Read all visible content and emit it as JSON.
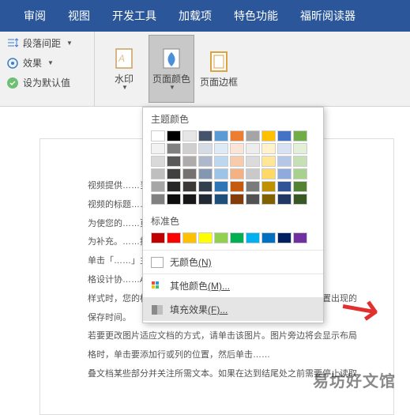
{
  "ribbon": {
    "tabs": [
      "审阅",
      "视图",
      "开发工具",
      "加载项",
      "特色功能",
      "福昕阅读器"
    ]
  },
  "leftGroup": {
    "paragraphSpacing": "段落间距",
    "effects": "效果",
    "setDefault": "设为默认值"
  },
  "pageBg": {
    "watermark": "水印",
    "pageColor": "页面颜色",
    "pageBorder": "页面边框"
  },
  "colorMenu": {
    "themeTitle": "主题颜色",
    "themeColors": [
      "#ffffff",
      "#000000",
      "#e7e6e6",
      "#44546a",
      "#5b9bd5",
      "#ed7d31",
      "#a5a5a5",
      "#ffc000",
      "#4472c4",
      "#70ad47",
      "#f2f2f2",
      "#808080",
      "#d0cece",
      "#d6dce5",
      "#deebf7",
      "#fce5d6",
      "#ededed",
      "#fff2cc",
      "#d9e2f3",
      "#e2f0d9",
      "#d9d9d9",
      "#595959",
      "#aeabab",
      "#adb9ca",
      "#bdd7ee",
      "#f8cbad",
      "#dbdbdb",
      "#ffe699",
      "#b4c7e7",
      "#c5e0b4",
      "#bfbfbf",
      "#404040",
      "#757171",
      "#8497b0",
      "#9dc3e6",
      "#f4b183",
      "#c9c9c9",
      "#ffd966",
      "#8faadc",
      "#a9d18e",
      "#a6a6a6",
      "#262626",
      "#3b3838",
      "#323f4f",
      "#2e75b6",
      "#c55a11",
      "#7b7b7b",
      "#bf9000",
      "#2f5597",
      "#548235",
      "#808080",
      "#0d0d0d",
      "#171717",
      "#222a35",
      "#1f4e79",
      "#843c0c",
      "#525252",
      "#806000",
      "#203864",
      "#385723"
    ],
    "standardTitle": "标准色",
    "standardColors": [
      "#c00000",
      "#ff0000",
      "#ffc000",
      "#ffff00",
      "#92d050",
      "#00b050",
      "#00b0f0",
      "#0070c0",
      "#002060",
      "#7030a0"
    ],
    "noColor": "无颜色",
    "noColorKey": "(N)",
    "otherColors": "其他颜色",
    "otherColorsKey": "(M)...",
    "fillEffects": "填充效果",
    "fillEffectsKey": "(F)..."
  },
  "doc": {
    "lines": [
      "视频提供……当您单击联机视频时",
      "视频的标题……个关键字以联机搜索最适",
      "为使您的……页脚、封面和文本框",
      "为补充。……提要栏。",
      "单击「……」主题和样式也有助于文",
      "格设计协……Art、图形将会更改以匹",
      "样式时，您的标题会进行更改以匹配新的主题。使用在需要位置出现的",
      "保存时间。",
      "若要更改图片适应文档的方式，请单击该图片。图片旁边将会显示布局",
      "格时，单击要添加行或列的位置，然后单击……",
      "叠文档某些部分并关注所需文本。如果在达到结尾处之前需要停止读取"
    ]
  },
  "watermark": "易坊好文馆"
}
